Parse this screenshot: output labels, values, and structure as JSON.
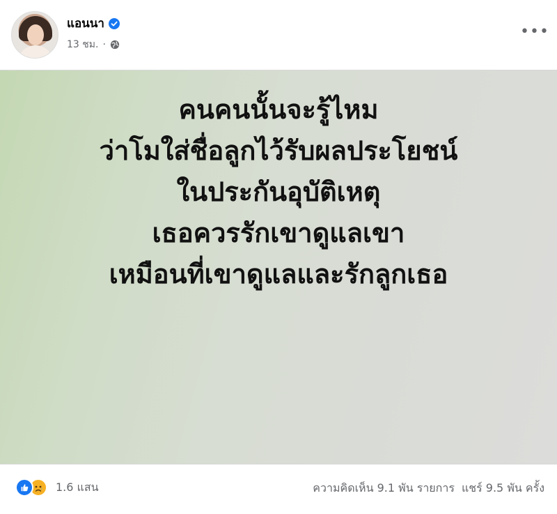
{
  "post": {
    "author": "แอนนา",
    "time": "13 ชม.",
    "image_text": [
      "คนคนนั้นจะรู้ไหม",
      "ว่าโมใส่ชื่อลูกไว้รับผลประโยชน์",
      "ในประกันอุบัติเหตุ",
      "เธอควรรักเขาดูแลเขา",
      "เหมือนที่เขาดูแลและรักลูกเธอ"
    ]
  },
  "footer": {
    "reactions_count": "1.6 แสน",
    "comments": "ความคิดเห็น 9.1 พัน รายการ",
    "shares": "แชร์ 9.5 พัน ครั้ง"
  },
  "colors": {
    "verified": "#1877f2",
    "like": "#1877f2",
    "sad": "#f7b125",
    "meta_text": "#65676b"
  }
}
